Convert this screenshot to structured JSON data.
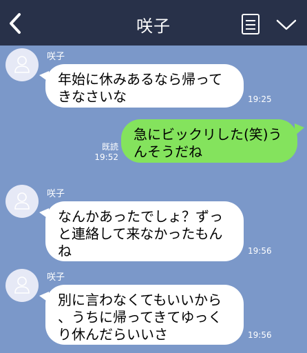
{
  "header": {
    "title": "咲子",
    "back_icon": "chevron-left-icon",
    "menu_icon": "list-icon",
    "chevron_icon": "chevron-down-icon",
    "bg_color": "#283149"
  },
  "chat": {
    "bg_color": "#7b98c9",
    "messages": [
      {
        "sender": "咲子",
        "lines": [
          "年始に休みあるなら帰って",
          "きなさいな"
        ],
        "time": "19:25"
      },
      {
        "lines": [
          "急にビックリした(笑)う",
          "んそうだね"
        ],
        "read": "既読",
        "time": "19:52",
        "bubble_color": "#84e35d"
      },
      {
        "sender": "咲子",
        "lines": [
          "なんかあったでしょ？ずっ",
          "と連絡して来なかったもん",
          "ね"
        ],
        "time": "19:56"
      },
      {
        "sender": "咲子",
        "lines": [
          "別に言わなくてもいいから",
          "、うちに帰ってきてゆっく",
          "り休んだらいいさ"
        ],
        "time": "19:56"
      }
    ]
  }
}
